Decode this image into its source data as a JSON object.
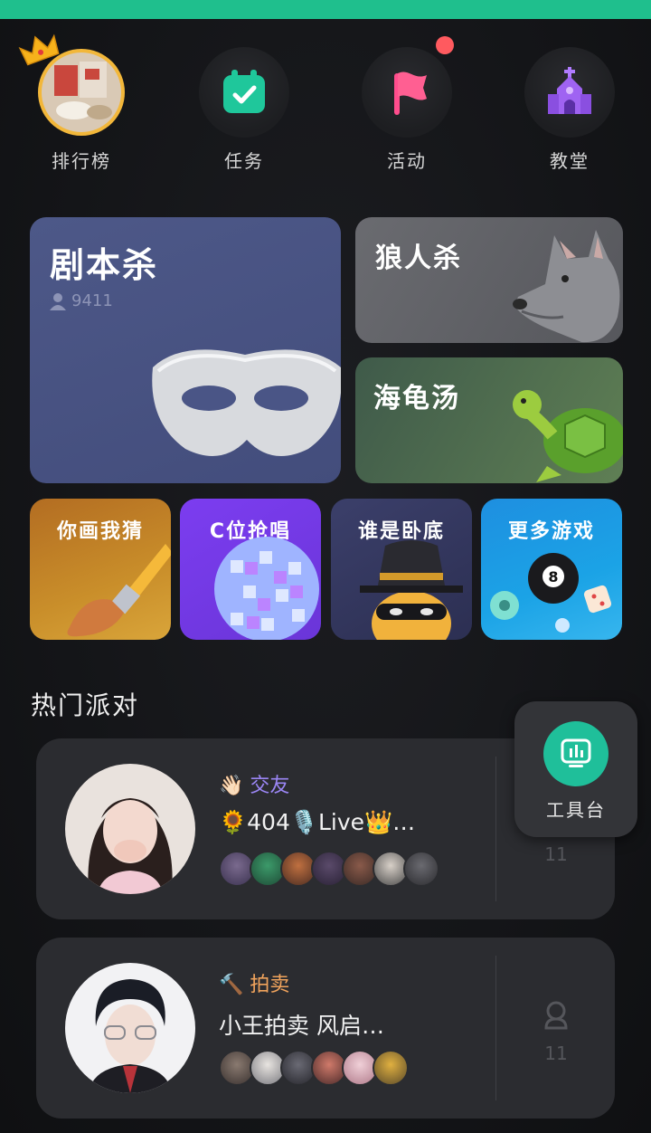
{
  "nav": [
    {
      "label": "排行榜",
      "icon": "leaderboard-avatar-icon"
    },
    {
      "label": "任务",
      "icon": "calendar-check-icon"
    },
    {
      "label": "活动",
      "icon": "flag-icon",
      "has_badge": true
    },
    {
      "label": "教堂",
      "icon": "church-icon"
    }
  ],
  "games": {
    "script_kill": {
      "title": "剧本杀",
      "players": "9411",
      "icon": "mask-icon",
      "color": "#4a5586"
    },
    "werewolf": {
      "title": "狼人杀",
      "icon": "wolf-icon",
      "color": "#5e5f63"
    },
    "turtle_soup": {
      "title": "海龟汤",
      "icon": "turtle-icon",
      "color": "#4d6e4a"
    },
    "draw_guess": {
      "title": "你画我猜",
      "icon": "paintbrush-icon"
    },
    "c_sing": {
      "title": "C位抢唱",
      "icon": "disco-ball-icon"
    },
    "undercover": {
      "title": "谁是卧底",
      "icon": "spy-icon"
    },
    "more_games": {
      "title": "更多游戏",
      "icon": "billiard-ball-icon"
    }
  },
  "section": {
    "hot_party": "热门派对"
  },
  "parties": [
    {
      "tag_icon": "👋🏻",
      "tag": "交友",
      "tag_color": "#9b86f5",
      "title": "🌻404🎙️Live👑…",
      "member_count": 7,
      "online": "11"
    },
    {
      "tag_icon": "🔨",
      "tag": "拍卖",
      "tag_color": "#f0a35c",
      "title": "小王拍卖 风启…",
      "member_count": 6,
      "online": "11"
    }
  ],
  "tool": {
    "label": "工具台",
    "icon": "dashboard-icon"
  },
  "colors": {
    "accent": "#1fbf8d",
    "badge": "#ff5a5f"
  }
}
